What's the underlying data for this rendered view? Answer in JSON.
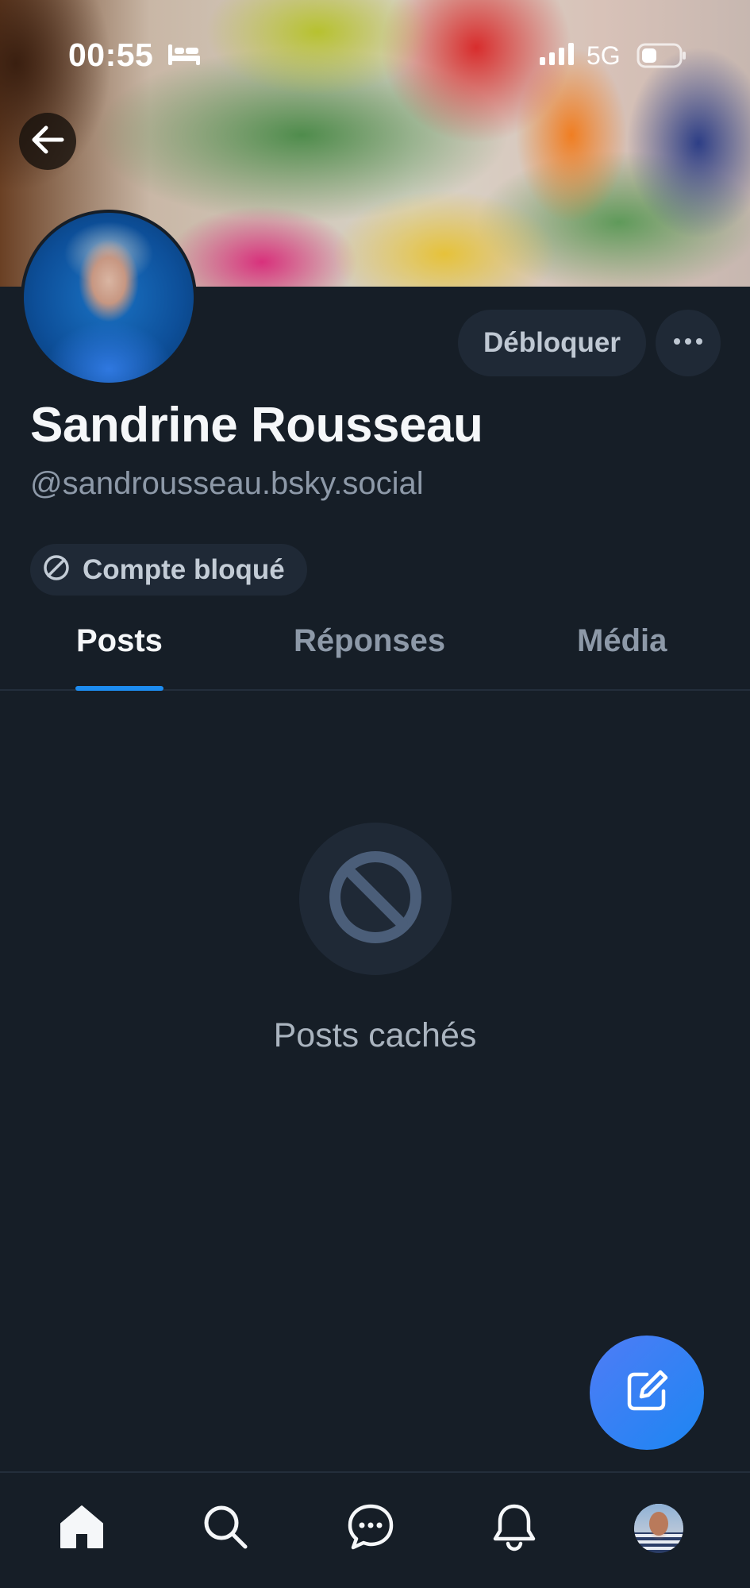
{
  "status_bar": {
    "time": "00:55",
    "network": "5G",
    "icons": [
      "bed-icon",
      "signal-icon",
      "battery-icon"
    ]
  },
  "header": {
    "back_icon": "arrow-left-icon"
  },
  "profile": {
    "display_name": "Sandrine Rousseau",
    "handle": "@sandrousseau.bsky.social",
    "unblock_label": "Débloquer",
    "more_icon": "ellipsis-icon",
    "blocked_badge_label": "Compte bloqué",
    "blocked_badge_icon": "block-icon"
  },
  "tabs": [
    {
      "label": "Posts",
      "active": true
    },
    {
      "label": "Réponses",
      "active": false
    },
    {
      "label": "Média",
      "active": false
    }
  ],
  "empty_state": {
    "icon": "block-icon",
    "text": "Posts cachés"
  },
  "fab": {
    "icon": "compose-icon"
  },
  "bottom_nav": [
    "home-icon",
    "search-icon",
    "chat-icon",
    "bell-icon",
    "avatar"
  ],
  "colors": {
    "background": "#161e27",
    "accent": "#1d8cf0",
    "fab_gradient_start": "#4f7cf6",
    "fab_gradient_end": "#1c86f2"
  }
}
